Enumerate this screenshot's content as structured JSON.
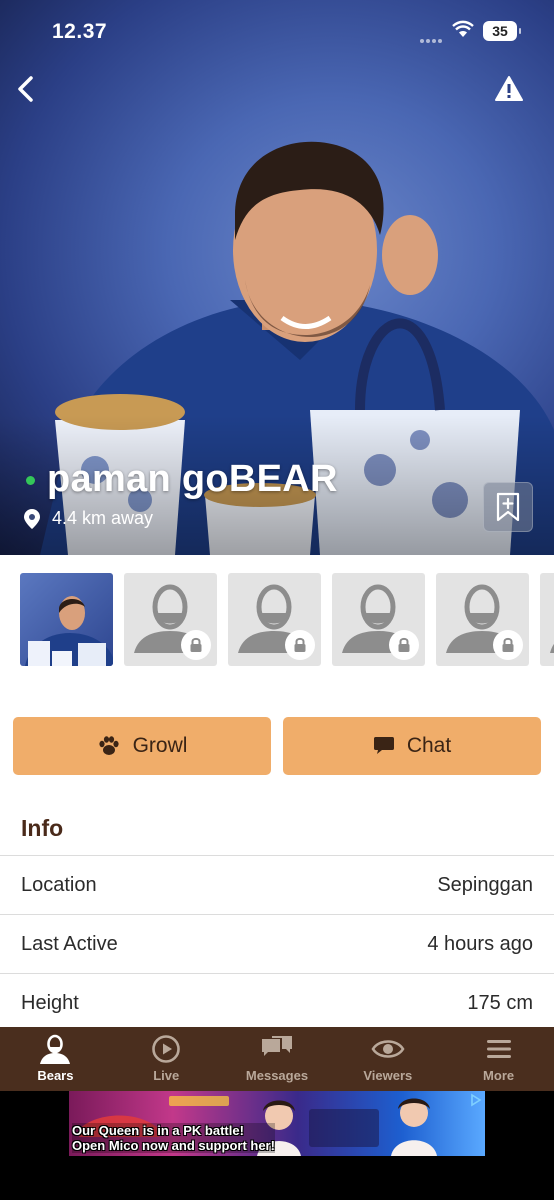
{
  "status_bar": {
    "time": "12.37",
    "battery": "35"
  },
  "profile": {
    "name": "paman goBEAR",
    "distance": "4.4 km away",
    "online": true
  },
  "icons": {
    "back": "chevron-left-icon",
    "report": "warning-icon",
    "bookmark": "bookmark-add-icon",
    "location": "location-pin-icon",
    "lock": "lock-icon"
  },
  "actions": {
    "growl_label": "Growl",
    "chat_label": "Chat"
  },
  "info": {
    "title": "Info",
    "rows": [
      {
        "label": "Location",
        "value": "Sepinggan"
      },
      {
        "label": "Last Active",
        "value": "4 hours ago"
      },
      {
        "label": "Height",
        "value": "175 cm"
      }
    ]
  },
  "tabs": [
    {
      "label": "Bears",
      "icon": "bear-icon",
      "active": true
    },
    {
      "label": "Live",
      "icon": "play-circle-icon",
      "active": false
    },
    {
      "label": "Messages",
      "icon": "messages-icon",
      "active": false
    },
    {
      "label": "Viewers",
      "icon": "eye-icon",
      "active": false
    },
    {
      "label": "More",
      "icon": "menu-icon",
      "active": false
    }
  ],
  "ad": {
    "line1": "Our Queen is in a PK battle!",
    "line2": "Open Mico now and support her!"
  },
  "colors": {
    "accent": "#f0ad6a",
    "tabbar": "#4a2e1e",
    "online": "#34c759",
    "info_title": "#4a2a1a"
  }
}
